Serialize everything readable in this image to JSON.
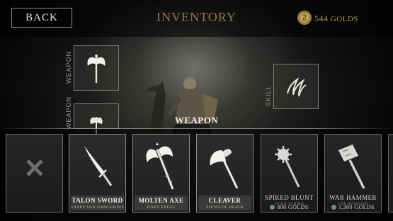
{
  "topbar": {
    "back_label": "BACK",
    "title": "INVENTORY",
    "gold_amount": "544",
    "gold_unit": "GOLDS"
  },
  "equipment": {
    "weapon_slot_label": "WEAPON",
    "weapon_slot_2_label": "WEAPON",
    "skill_slot_label": "SKILL"
  },
  "section": {
    "title": "WEAPON"
  },
  "items": [
    {
      "name": "",
      "subtitle": "",
      "price": "",
      "icon": "x-empty-icon"
    },
    {
      "name": "TALON SWORD",
      "subtitle": "SHARP AND DANGEROUS",
      "price": "",
      "icon": "sword-icon"
    },
    {
      "name": "MOLTEN AXE",
      "subtitle": "FIREY EDGES",
      "price": "",
      "icon": "double-axe-icon"
    },
    {
      "name": "CLEAVER",
      "subtitle": "EDGES OF DEATH",
      "price": "",
      "icon": "cleaver-icon"
    },
    {
      "name": "SPIKED BLUNT",
      "subtitle": "SPIKE STRIKE",
      "price": "800 GOLDS",
      "icon": "mace-icon"
    },
    {
      "name": "WAR HAMMER",
      "subtitle": "THE AVENGER",
      "price": "1,300 GOLDS",
      "icon": "hammer-icon"
    }
  ],
  "colors": {
    "accent_gold": "#b49a55",
    "title_gold": "#8c7a4a"
  }
}
